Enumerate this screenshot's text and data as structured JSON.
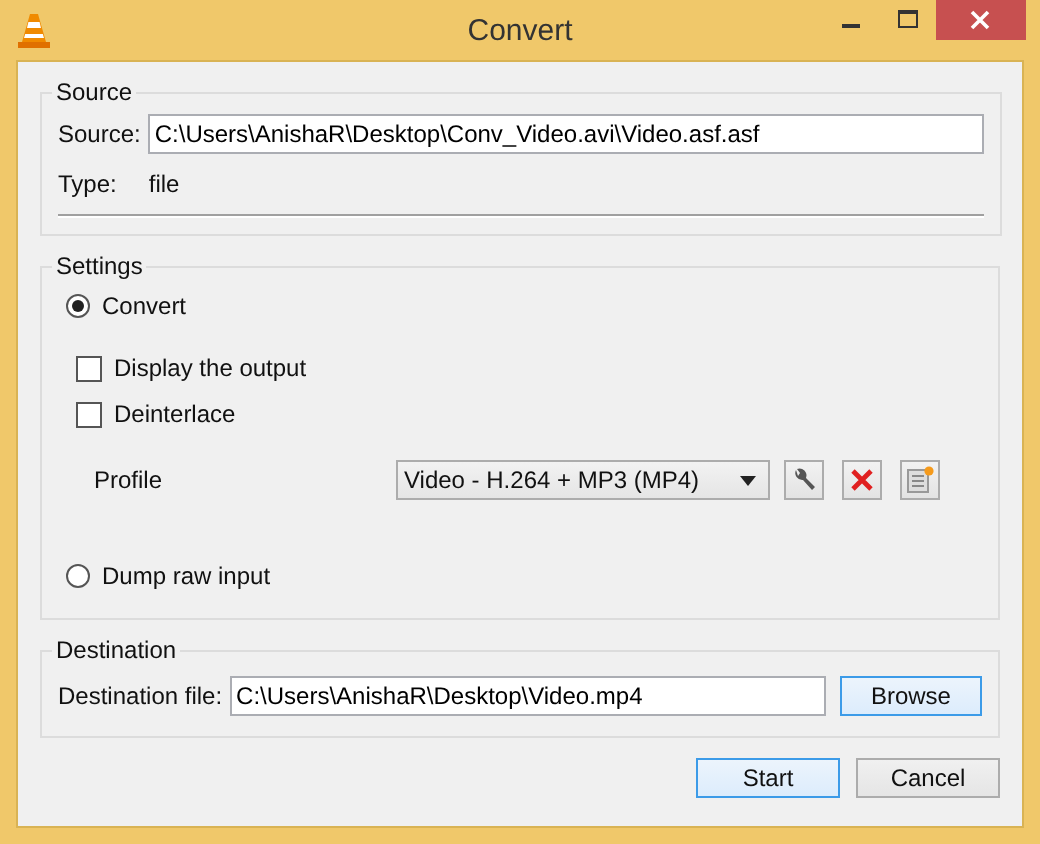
{
  "window": {
    "title": "Convert"
  },
  "source": {
    "title": "Source",
    "label": "Source:",
    "value": "C:\\Users\\AnishaR\\Desktop\\Conv_Video.avi\\Video.asf.asf",
    "type_label": "Type:",
    "type_value": "file"
  },
  "settings": {
    "title": "Settings",
    "convert": {
      "label": "Convert",
      "selected": true
    },
    "checkboxes": [
      {
        "label": "Display the output",
        "checked": false
      },
      {
        "label": "Deinterlace",
        "checked": false
      }
    ],
    "profile": {
      "label": "Profile",
      "value": "Video - H.264 + MP3 (MP4)"
    },
    "dump_raw": {
      "label": "Dump raw input",
      "selected": false
    }
  },
  "destination": {
    "title": "Destination",
    "label": "Destination file:",
    "value": "C:\\Users\\AnishaR\\Desktop\\Video.mp4",
    "browse": {
      "label": "Browse",
      "highlighted": true
    }
  },
  "buttons": [
    {
      "label": "Start",
      "highlighted": true
    },
    {
      "label": "Cancel",
      "highlighted": false
    }
  ]
}
